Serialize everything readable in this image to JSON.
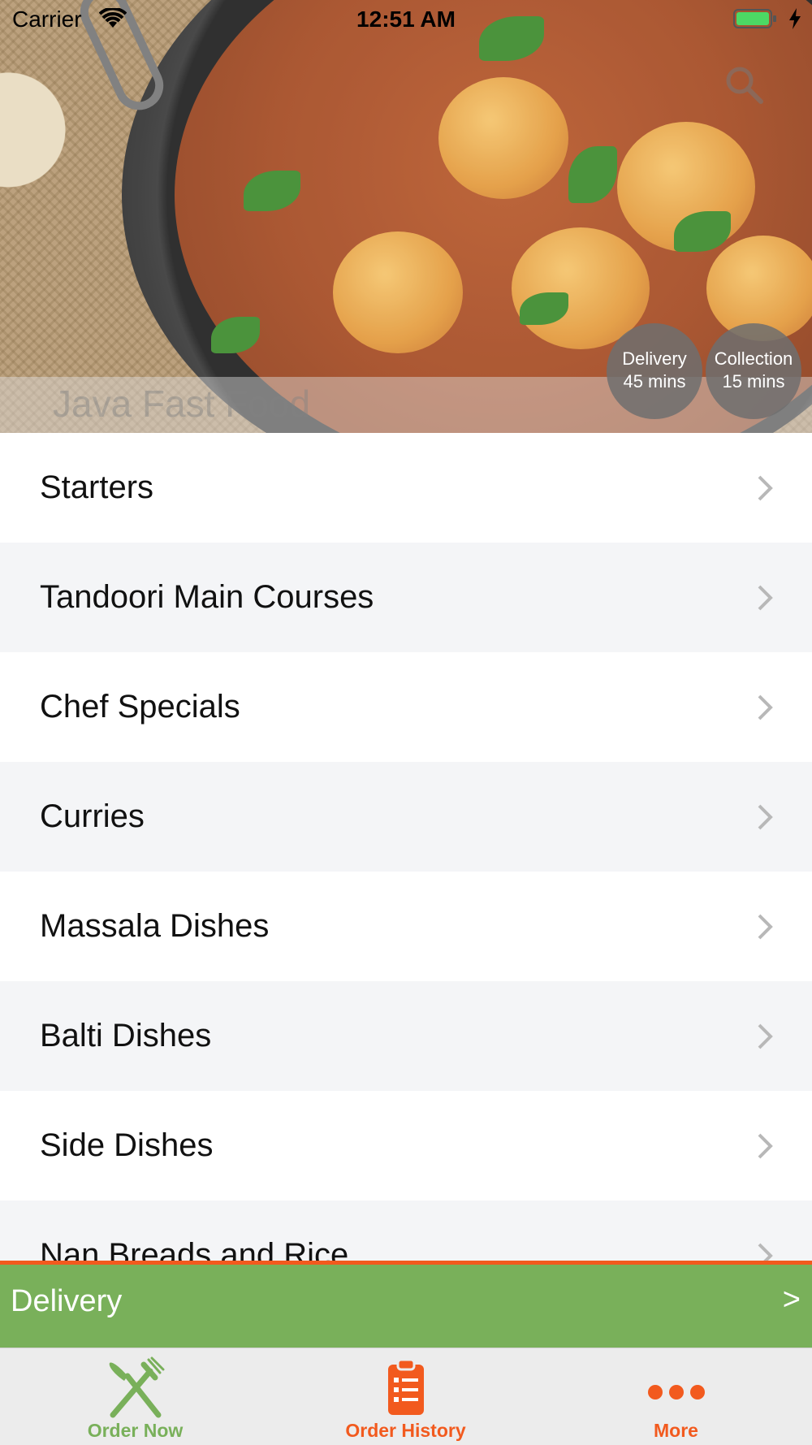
{
  "status_bar": {
    "carrier": "Carrier",
    "time": "12:51 AM"
  },
  "hero": {
    "restaurant_name": "Java Fast Food",
    "delivery_label": "Delivery",
    "delivery_time": "45 mins",
    "collection_label": "Collection",
    "collection_time": "15 mins"
  },
  "menu": {
    "items": [
      {
        "label": "Starters"
      },
      {
        "label": "Tandoori Main Courses"
      },
      {
        "label": "Chef Specials"
      },
      {
        "label": "Curries"
      },
      {
        "label": "Massala Dishes"
      },
      {
        "label": "Balti Dishes"
      },
      {
        "label": "Side Dishes"
      },
      {
        "label": "Nan Breads and Rice"
      }
    ]
  },
  "delivery_bar": {
    "label": "Delivery",
    "arrow": ">"
  },
  "tab_bar": {
    "tabs": [
      {
        "label": "Order Now",
        "icon": "fork-knife-icon"
      },
      {
        "label": "Order History",
        "icon": "clipboard-icon"
      },
      {
        "label": "More",
        "icon": "more-dots-icon"
      }
    ]
  },
  "colors": {
    "accent_green": "#79b05a",
    "accent_orange": "#f25a1e",
    "row_alt": "#f4f5f7"
  }
}
